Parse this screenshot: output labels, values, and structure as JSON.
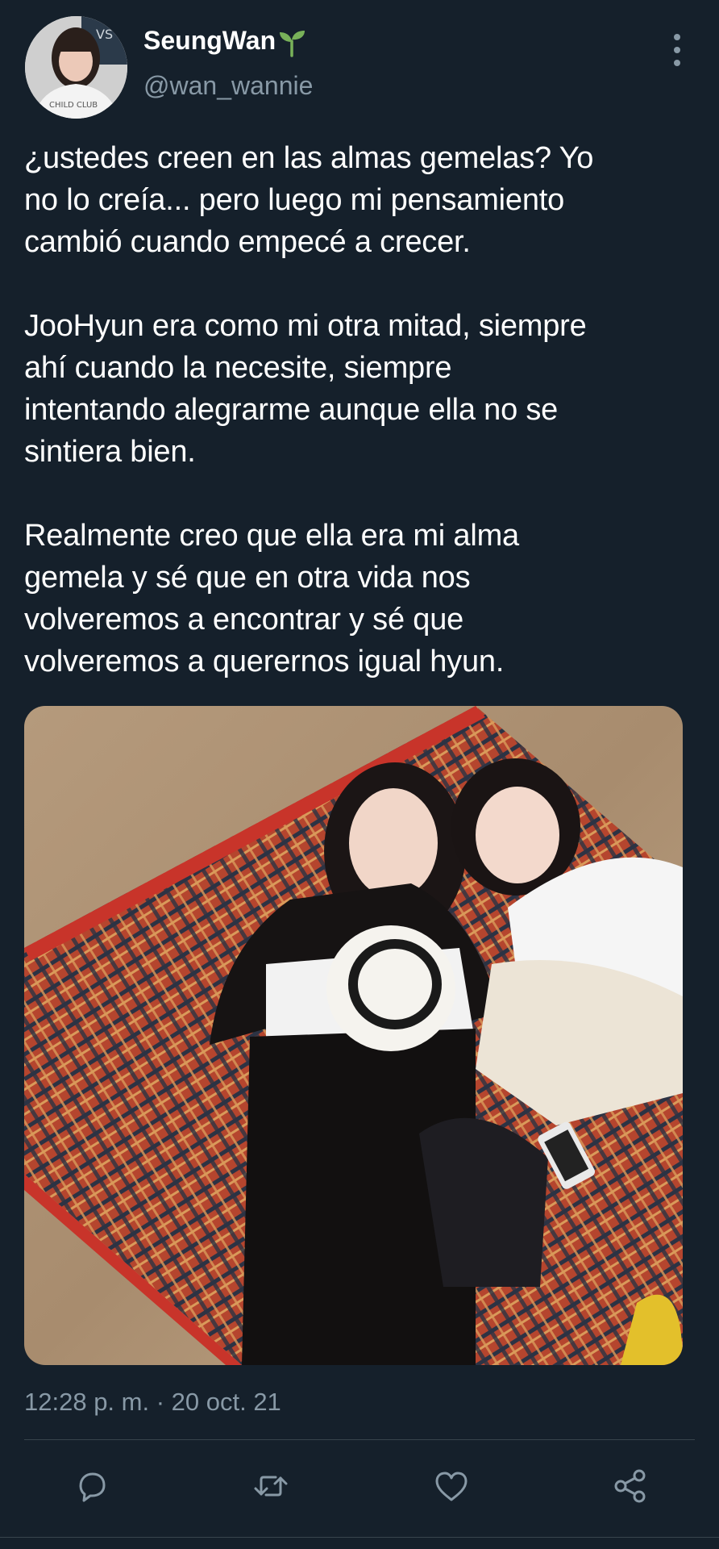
{
  "author": {
    "display_name": "SeungWan",
    "handle": "@wan_wannie",
    "name_emoji": "sprout-icon"
  },
  "tweet": {
    "paragraphs": [
      "¿ustedes creen en las almas gemelas? Yo\nno lo creía... pero luego mi pensamiento\ncambió cuando empecé a crecer.",
      "JooHyun era como mi otra mitad, siempre\nahí cuando la necesite, siempre\nintentando alegrarme aunque ella no se\nsintiera bien.",
      "Realmente creo que ella era mi alma\ngemela y sé que en otra vida nos\nvolveremos a encontrar y sé que\nvolveremos a querernos igual hyun."
    ],
    "timestamp": "12:28 p. m. · 20 oct. 21"
  },
  "actions": [
    {
      "name": "reply-icon"
    },
    {
      "name": "retweet-icon"
    },
    {
      "name": "like-icon"
    },
    {
      "name": "share-icon"
    }
  ],
  "colors": {
    "background": "#15202b",
    "secondary_text": "#8899a6",
    "divider": "#38444d",
    "sprout": "#78b159"
  }
}
